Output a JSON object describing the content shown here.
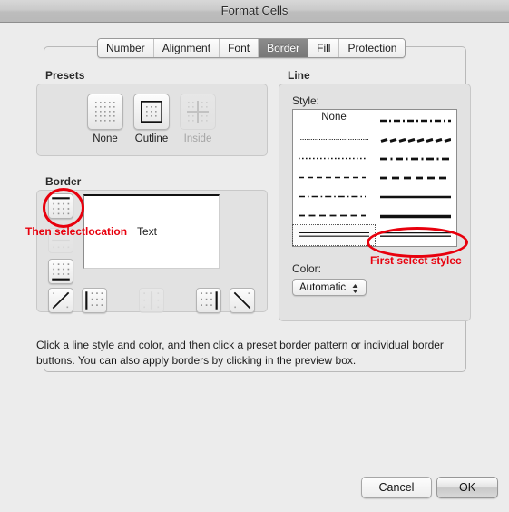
{
  "window": {
    "title": "Format Cells"
  },
  "tabs": [
    {
      "label": "Number",
      "selected": false
    },
    {
      "label": "Alignment",
      "selected": false
    },
    {
      "label": "Font",
      "selected": false
    },
    {
      "label": "Border",
      "selected": true
    },
    {
      "label": "Fill",
      "selected": false
    },
    {
      "label": "Protection",
      "selected": false
    }
  ],
  "presets": {
    "label": "Presets",
    "items": [
      {
        "label": "None",
        "icon": "border-none-icon",
        "enabled": true
      },
      {
        "label": "Outline",
        "icon": "border-outline-icon",
        "enabled": true
      },
      {
        "label": "Inside",
        "icon": "border-inside-icon",
        "enabled": false
      }
    ]
  },
  "border": {
    "label": "Border",
    "preview_text": "Text",
    "buttons": [
      {
        "name": "border-top-button",
        "enabled": true
      },
      {
        "name": "border-middle-horizontal-button",
        "enabled": false
      },
      {
        "name": "border-bottom-button",
        "enabled": true
      },
      {
        "name": "border-diagonal-up-button",
        "enabled": true
      },
      {
        "name": "border-left-button",
        "enabled": true
      },
      {
        "name": "border-middle-vertical-button",
        "enabled": false
      },
      {
        "name": "border-right-button",
        "enabled": true
      },
      {
        "name": "border-diagonal-down-button",
        "enabled": true
      }
    ]
  },
  "line": {
    "label": "Line",
    "style_label": "Style:",
    "none_label": "None",
    "styles": [
      {
        "id": "none",
        "column": "left",
        "row": 0,
        "pattern": "none",
        "selected": false
      },
      {
        "id": "hairline-dot",
        "column": "left",
        "row": 1,
        "pattern": "fine-dotted",
        "selected": false
      },
      {
        "id": "dotted",
        "column": "left",
        "row": 2,
        "pattern": "dotted",
        "selected": false
      },
      {
        "id": "thin-dashed",
        "column": "left",
        "row": 3,
        "pattern": "dashed-thin",
        "selected": false
      },
      {
        "id": "dash-dot",
        "column": "left",
        "row": 4,
        "pattern": "dash-dot",
        "selected": false
      },
      {
        "id": "dashed",
        "column": "left",
        "row": 5,
        "pattern": "dashed",
        "selected": false
      },
      {
        "id": "double",
        "column": "left",
        "row": 6,
        "pattern": "double",
        "selected": true
      },
      {
        "id": "dash-dot-thick",
        "column": "right",
        "row": 0,
        "pattern": "dash-dot-b",
        "selected": false
      },
      {
        "id": "dash-slant",
        "column": "right",
        "row": 1,
        "pattern": "dash-slant",
        "selected": false
      },
      {
        "id": "dash-dot-med",
        "column": "right",
        "row": 2,
        "pattern": "dash-dot-m",
        "selected": false
      },
      {
        "id": "med-dashed",
        "column": "right",
        "row": 3,
        "pattern": "dashed-med",
        "selected": false
      },
      {
        "id": "medium-solid",
        "column": "right",
        "row": 4,
        "pattern": "solid-med",
        "selected": false
      },
      {
        "id": "thick-solid",
        "column": "right",
        "row": 5,
        "pattern": "solid-thick",
        "selected": false
      },
      {
        "id": "double-thick",
        "column": "right",
        "row": 6,
        "pattern": "double-b",
        "selected": false
      }
    ],
    "color_label": "Color:",
    "color_value": "Automatic"
  },
  "help_text": "Click a line style and color, and then click a preset border pattern or individual border buttons. You can also apply borders by clicking in the preview box.",
  "footer": {
    "cancel_label": "Cancel",
    "ok_label": "OK"
  },
  "annotations": [
    {
      "id": "then-select-location",
      "text": "Then  selectlocation",
      "color": "#e8000d"
    },
    {
      "id": "first-select-style",
      "text": "First select stylec",
      "color": "#e8000d"
    }
  ]
}
